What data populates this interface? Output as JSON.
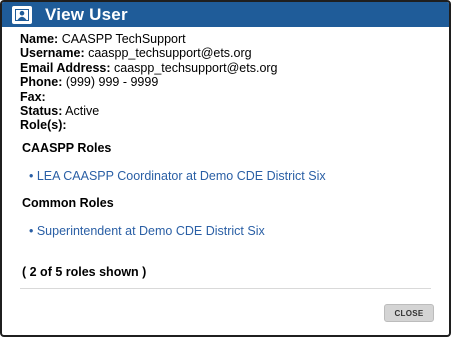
{
  "dialog": {
    "title": "View User",
    "title_icon": "user-card-icon",
    "colors": {
      "titlebar": "#1f5c99",
      "link": "#2a5fa5",
      "button": "#d4d4d4"
    }
  },
  "user": {
    "name_label": "Name:",
    "name_value": "CAASPP TechSupport",
    "username_label": "Username:",
    "username_value": "caaspp_techsupport@ets.org",
    "email_label": "Email Address:",
    "email_value": "caaspp_techsupport@ets.org",
    "phone_label": "Phone:",
    "phone_value": "(999) 999 - 9999",
    "fax_label": "Fax:",
    "fax_value": "",
    "status_label": "Status:",
    "status_value": "Active",
    "roles_label": "Role(s):"
  },
  "caaspp_roles": {
    "heading": "CAASPP Roles",
    "items": [
      "• LEA CAASPP Coordinator at Demo CDE District Six"
    ]
  },
  "common_roles": {
    "heading": "Common Roles",
    "items": [
      "• Superintendent at Demo CDE District Six"
    ]
  },
  "roles_shown": "( 2 of 5 roles shown )",
  "footer": {
    "close_label": "CLOSE"
  }
}
